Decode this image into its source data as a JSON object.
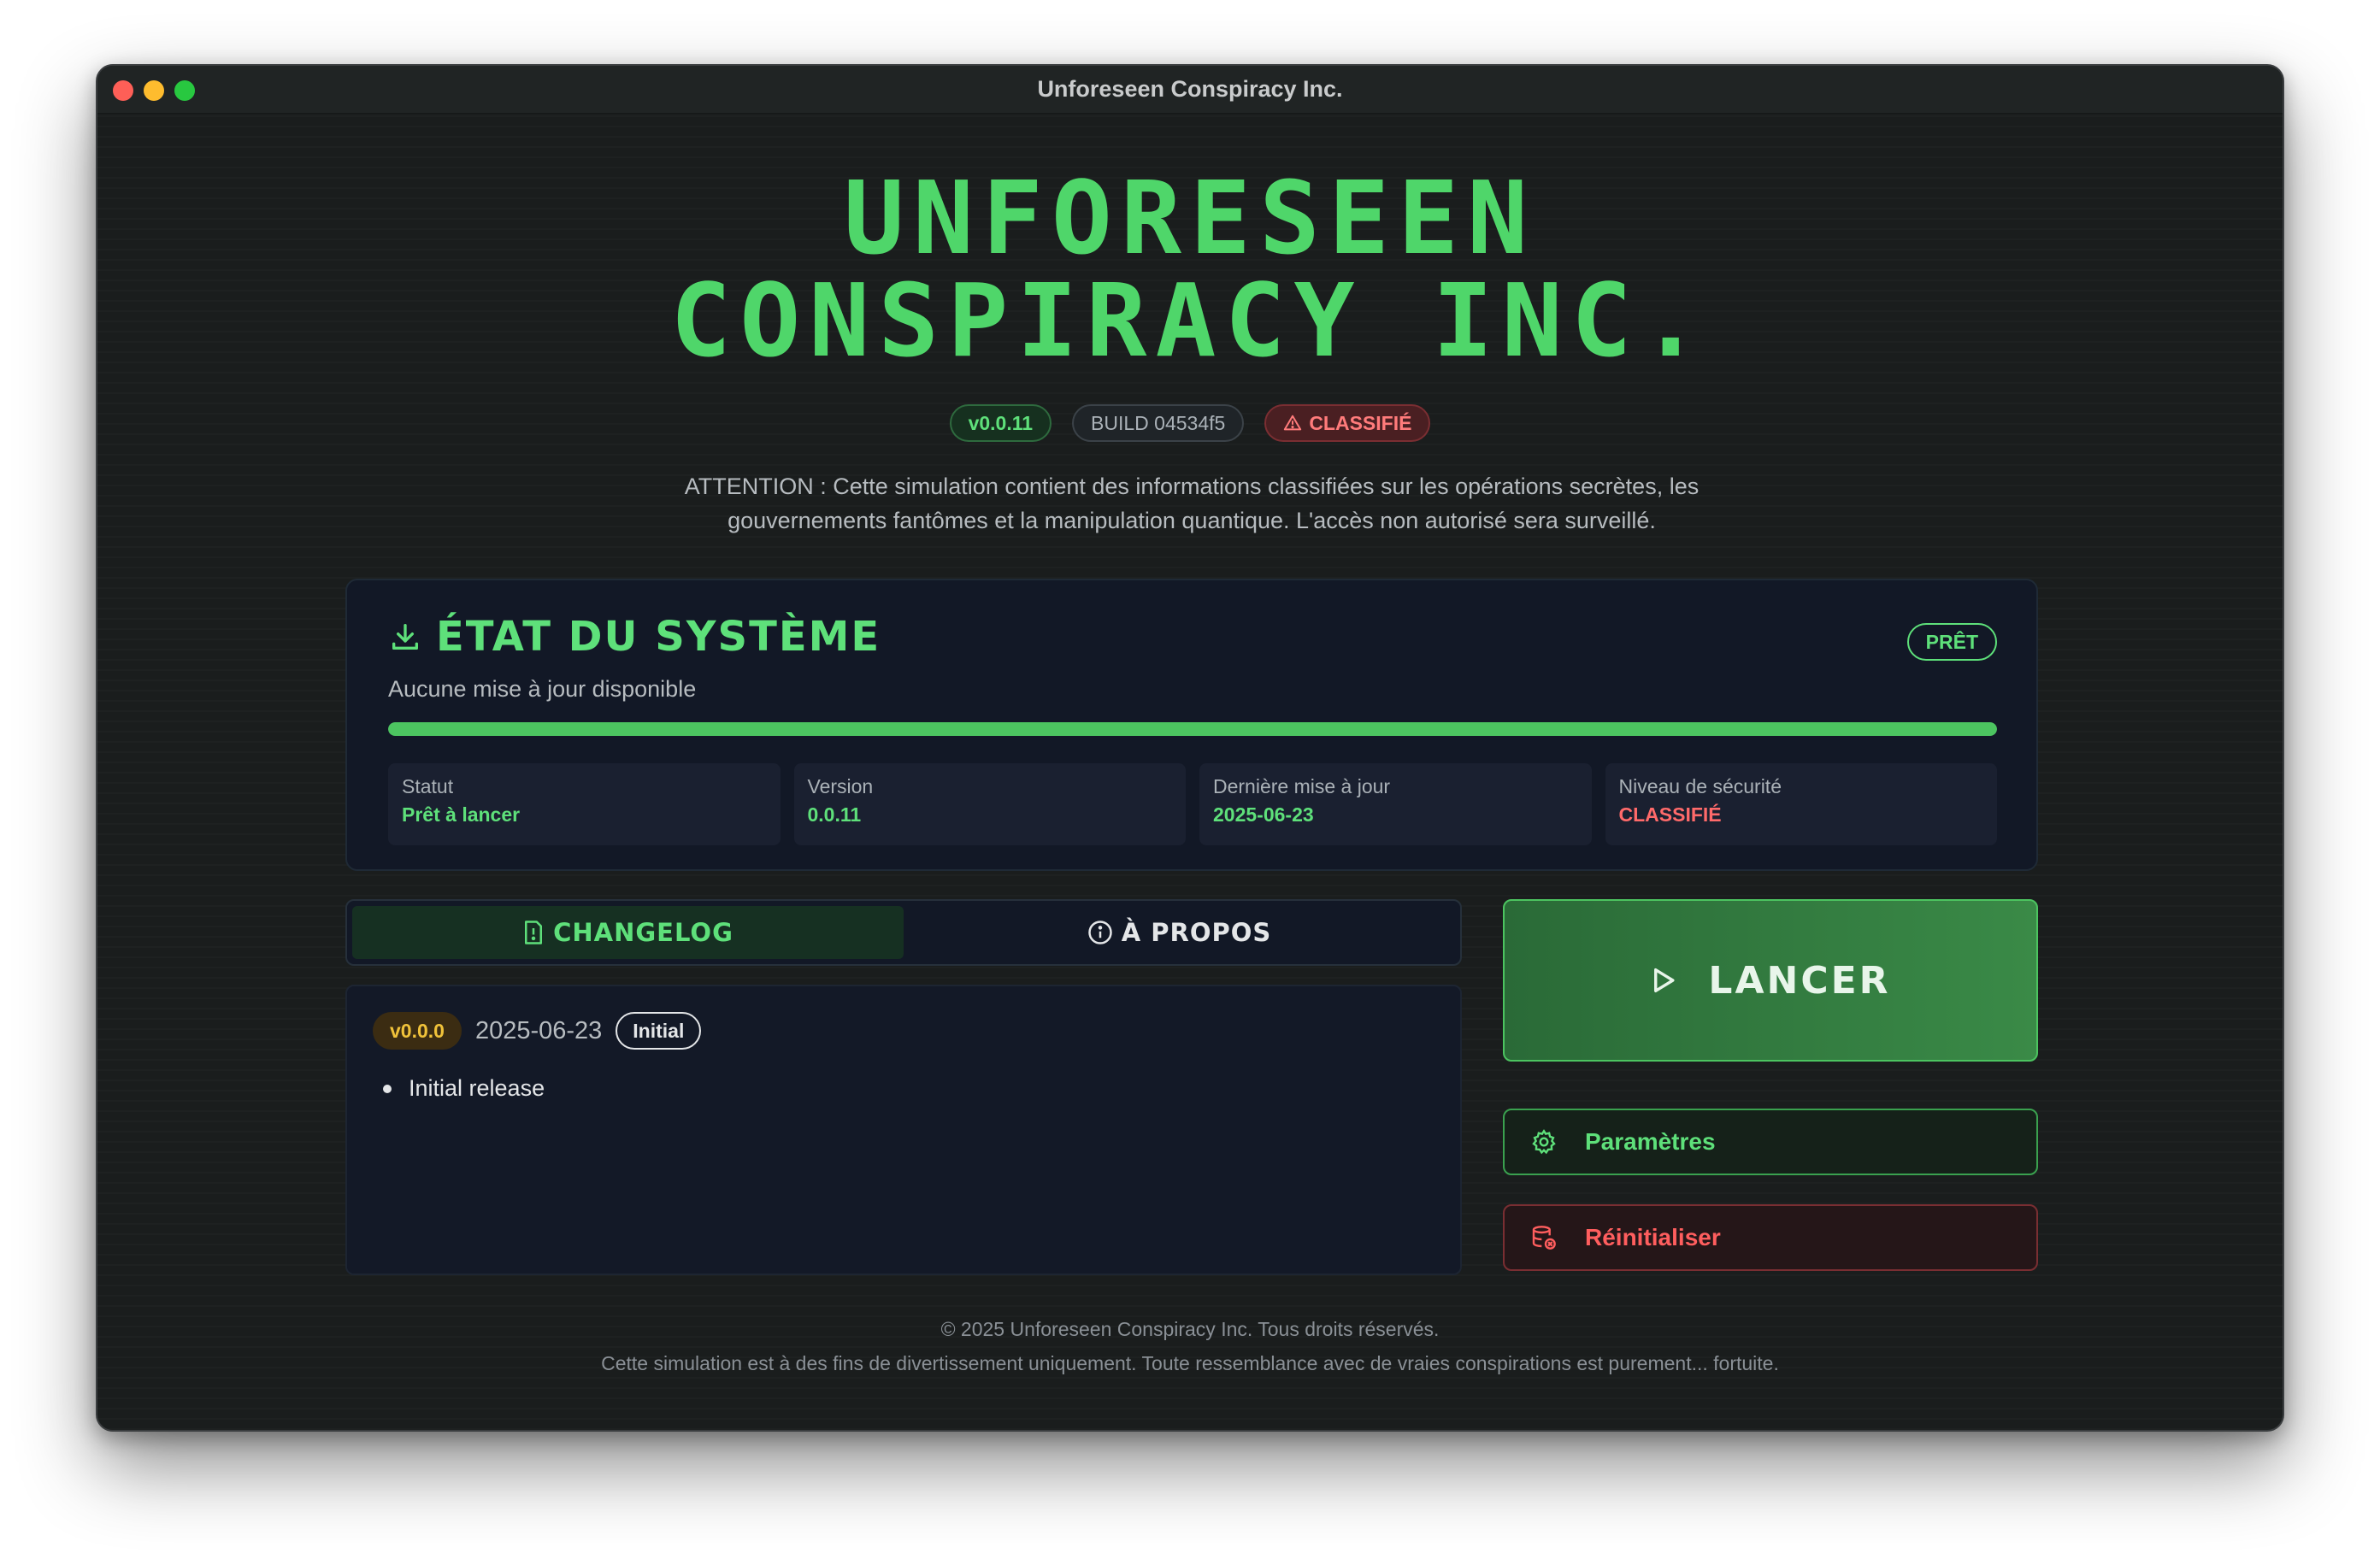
{
  "window": {
    "title": "Unforeseen Conspiracy Inc."
  },
  "hero": {
    "title_line1": "UNFORESEEN",
    "title_line2": "CONSPIRACY INC."
  },
  "badges": {
    "version": "v0.0.11",
    "build": "BUILD 04534f5",
    "classification": "CLASSIFIÉ"
  },
  "warning": {
    "line1": "ATTENTION : Cette simulation contient des informations classifiées sur les opérations secrètes, les",
    "line2": "gouvernements fantômes et la manipulation quantique. L'accès non autorisé sera surveillé."
  },
  "status_card": {
    "title": "ÉTAT DU SYSTÈME",
    "state_badge": "PRÊT",
    "subtitle": "Aucune mise à jour disponible",
    "progress": 1.0,
    "info": [
      {
        "label": "Statut",
        "value": "Prêt à lancer",
        "tone": "green"
      },
      {
        "label": "Version",
        "value": "0.0.11",
        "tone": "green"
      },
      {
        "label": "Dernière mise à jour",
        "value": "2025-06-23",
        "tone": "green"
      },
      {
        "label": "Niveau de sécurité",
        "value": "CLASSIFIÉ",
        "tone": "red"
      }
    ]
  },
  "tabs": {
    "changelog": "CHANGELOG",
    "about": "À PROPOS"
  },
  "changelog": {
    "version": "v0.0.0",
    "date": "2025-06-23",
    "tag": "Initial",
    "items": [
      "Initial release"
    ]
  },
  "actions": {
    "launch": "LANCER",
    "settings": "Paramètres",
    "reset": "Réinitialiser"
  },
  "footer": {
    "copyright": "© 2025 Unforeseen Conspiracy Inc. Tous droits réservés.",
    "disclaimer": "Cette simulation est à des fins de divertissement uniquement. Toute ressemblance avec de vraies conspirations est purement... fortuite."
  },
  "colors": {
    "accent": "#4fd66a",
    "danger": "#ff6a6a",
    "warning": "#f0c23a",
    "background": "#1a1d1d",
    "panel": "#121826"
  }
}
